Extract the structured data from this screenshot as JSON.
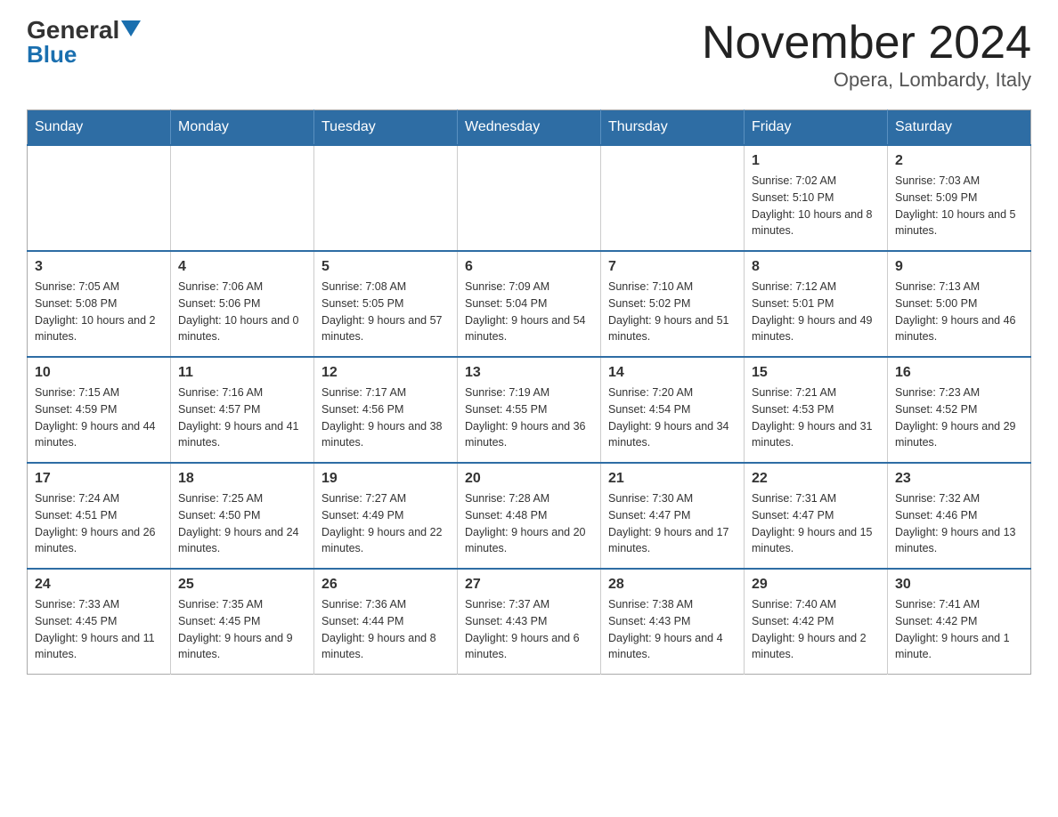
{
  "header": {
    "logo_general": "General",
    "logo_blue": "Blue",
    "month_title": "November 2024",
    "location": "Opera, Lombardy, Italy"
  },
  "days_of_week": [
    "Sunday",
    "Monday",
    "Tuesday",
    "Wednesday",
    "Thursday",
    "Friday",
    "Saturday"
  ],
  "weeks": [
    [
      {
        "day": "",
        "info": ""
      },
      {
        "day": "",
        "info": ""
      },
      {
        "day": "",
        "info": ""
      },
      {
        "day": "",
        "info": ""
      },
      {
        "day": "",
        "info": ""
      },
      {
        "day": "1",
        "info": "Sunrise: 7:02 AM\nSunset: 5:10 PM\nDaylight: 10 hours and 8 minutes."
      },
      {
        "day": "2",
        "info": "Sunrise: 7:03 AM\nSunset: 5:09 PM\nDaylight: 10 hours and 5 minutes."
      }
    ],
    [
      {
        "day": "3",
        "info": "Sunrise: 7:05 AM\nSunset: 5:08 PM\nDaylight: 10 hours and 2 minutes."
      },
      {
        "day": "4",
        "info": "Sunrise: 7:06 AM\nSunset: 5:06 PM\nDaylight: 10 hours and 0 minutes."
      },
      {
        "day": "5",
        "info": "Sunrise: 7:08 AM\nSunset: 5:05 PM\nDaylight: 9 hours and 57 minutes."
      },
      {
        "day": "6",
        "info": "Sunrise: 7:09 AM\nSunset: 5:04 PM\nDaylight: 9 hours and 54 minutes."
      },
      {
        "day": "7",
        "info": "Sunrise: 7:10 AM\nSunset: 5:02 PM\nDaylight: 9 hours and 51 minutes."
      },
      {
        "day": "8",
        "info": "Sunrise: 7:12 AM\nSunset: 5:01 PM\nDaylight: 9 hours and 49 minutes."
      },
      {
        "day": "9",
        "info": "Sunrise: 7:13 AM\nSunset: 5:00 PM\nDaylight: 9 hours and 46 minutes."
      }
    ],
    [
      {
        "day": "10",
        "info": "Sunrise: 7:15 AM\nSunset: 4:59 PM\nDaylight: 9 hours and 44 minutes."
      },
      {
        "day": "11",
        "info": "Sunrise: 7:16 AM\nSunset: 4:57 PM\nDaylight: 9 hours and 41 minutes."
      },
      {
        "day": "12",
        "info": "Sunrise: 7:17 AM\nSunset: 4:56 PM\nDaylight: 9 hours and 38 minutes."
      },
      {
        "day": "13",
        "info": "Sunrise: 7:19 AM\nSunset: 4:55 PM\nDaylight: 9 hours and 36 minutes."
      },
      {
        "day": "14",
        "info": "Sunrise: 7:20 AM\nSunset: 4:54 PM\nDaylight: 9 hours and 34 minutes."
      },
      {
        "day": "15",
        "info": "Sunrise: 7:21 AM\nSunset: 4:53 PM\nDaylight: 9 hours and 31 minutes."
      },
      {
        "day": "16",
        "info": "Sunrise: 7:23 AM\nSunset: 4:52 PM\nDaylight: 9 hours and 29 minutes."
      }
    ],
    [
      {
        "day": "17",
        "info": "Sunrise: 7:24 AM\nSunset: 4:51 PM\nDaylight: 9 hours and 26 minutes."
      },
      {
        "day": "18",
        "info": "Sunrise: 7:25 AM\nSunset: 4:50 PM\nDaylight: 9 hours and 24 minutes."
      },
      {
        "day": "19",
        "info": "Sunrise: 7:27 AM\nSunset: 4:49 PM\nDaylight: 9 hours and 22 minutes."
      },
      {
        "day": "20",
        "info": "Sunrise: 7:28 AM\nSunset: 4:48 PM\nDaylight: 9 hours and 20 minutes."
      },
      {
        "day": "21",
        "info": "Sunrise: 7:30 AM\nSunset: 4:47 PM\nDaylight: 9 hours and 17 minutes."
      },
      {
        "day": "22",
        "info": "Sunrise: 7:31 AM\nSunset: 4:47 PM\nDaylight: 9 hours and 15 minutes."
      },
      {
        "day": "23",
        "info": "Sunrise: 7:32 AM\nSunset: 4:46 PM\nDaylight: 9 hours and 13 minutes."
      }
    ],
    [
      {
        "day": "24",
        "info": "Sunrise: 7:33 AM\nSunset: 4:45 PM\nDaylight: 9 hours and 11 minutes."
      },
      {
        "day": "25",
        "info": "Sunrise: 7:35 AM\nSunset: 4:45 PM\nDaylight: 9 hours and 9 minutes."
      },
      {
        "day": "26",
        "info": "Sunrise: 7:36 AM\nSunset: 4:44 PM\nDaylight: 9 hours and 8 minutes."
      },
      {
        "day": "27",
        "info": "Sunrise: 7:37 AM\nSunset: 4:43 PM\nDaylight: 9 hours and 6 minutes."
      },
      {
        "day": "28",
        "info": "Sunrise: 7:38 AM\nSunset: 4:43 PM\nDaylight: 9 hours and 4 minutes."
      },
      {
        "day": "29",
        "info": "Sunrise: 7:40 AM\nSunset: 4:42 PM\nDaylight: 9 hours and 2 minutes."
      },
      {
        "day": "30",
        "info": "Sunrise: 7:41 AM\nSunset: 4:42 PM\nDaylight: 9 hours and 1 minute."
      }
    ]
  ]
}
